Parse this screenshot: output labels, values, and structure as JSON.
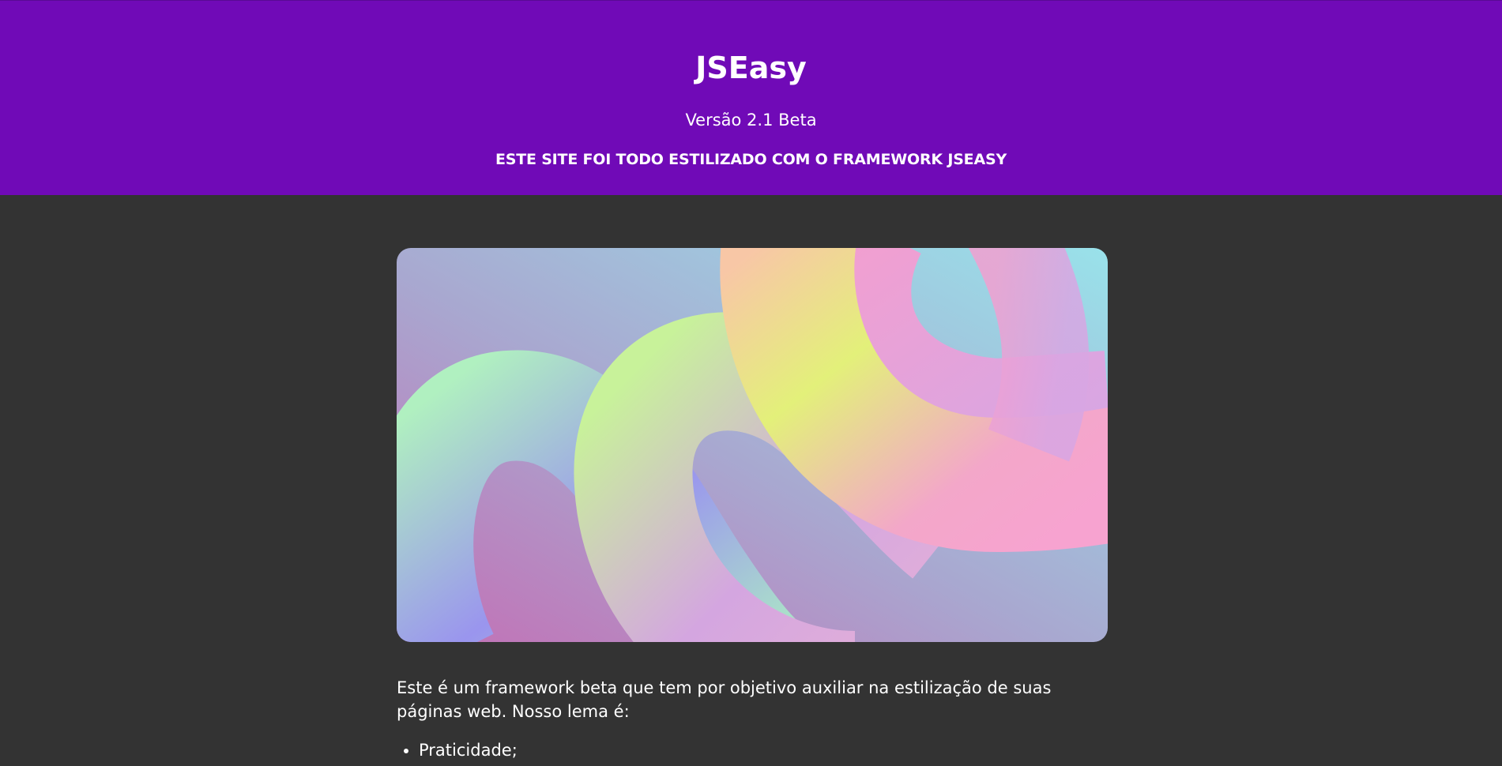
{
  "header": {
    "title": "JSEasy",
    "version": "Versão 2.1 Beta",
    "tagline": "ESTE SITE FOI TODO ESTILIZADO COM O FRAMEWORK JSEASY"
  },
  "hero": {
    "description": "abstract pastel gradient swirls image"
  },
  "content": {
    "intro": "Este é um framework beta que tem por objetivo auxiliar na estilização de suas páginas web. Nosso lema é:",
    "motto": [
      "Praticidade;"
    ]
  },
  "colors": {
    "header_bg": "#700ab7",
    "page_bg": "#333333",
    "text": "#ffffff"
  }
}
